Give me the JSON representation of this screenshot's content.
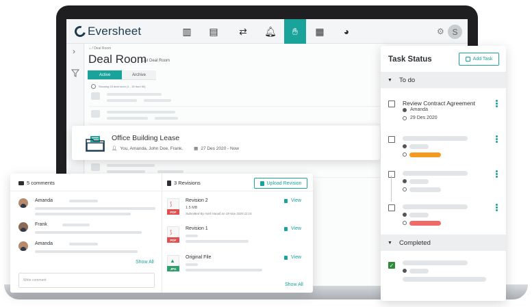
{
  "app": {
    "brand": "Eversheet",
    "avatar_letter": "S",
    "nav_icons": [
      "buildings-icon",
      "document-icon",
      "transfer-icon",
      "bell-icon",
      "handshake-icon",
      "clipboard-icon",
      "pie-chart-icon"
    ],
    "active_nav": "handshake-icon"
  },
  "deal_room": {
    "breadcrumb": "/ Deal Room",
    "title": "Deal Room",
    "subtitle": "List Deal Room",
    "tabs": [
      "Active",
      "Archive"
    ],
    "active_tab": "Active",
    "showing_text": "Showing 15 deal room (1 - 15 from 50)"
  },
  "featured_deal": {
    "title": "Office Building Lease",
    "members": "You, Amanda, John Doe, Frank.",
    "date_range": "27 Des 2020 - Now"
  },
  "comments": {
    "header": "5 comments",
    "items": [
      {
        "name": "Amanda"
      },
      {
        "name": "Frank"
      },
      {
        "name": "Amanda"
      }
    ],
    "show_all": "Show All",
    "write_placeholder": "Write comment"
  },
  "revisions": {
    "header": "3 Revisions",
    "upload_label": "Upload Revision",
    "items": [
      {
        "name": "Revision 2",
        "size": "1.5 MB",
        "submitted": "Submitted By Arief Hanafi on 19 Nov 2020 11:15",
        "type": "PDF",
        "view": "View"
      },
      {
        "name": "Revision 1",
        "size": "",
        "submitted": "",
        "type": "PDF",
        "view": "View"
      },
      {
        "name": "Original File",
        "size": "",
        "submitted": "",
        "type": "JPG",
        "view": "View"
      }
    ],
    "show_all": "Show All"
  },
  "task_status": {
    "title": "Task Status",
    "add_label": "Add Task",
    "todo_label": "To do",
    "completed_label": "Completed",
    "first_task": {
      "name": "Review Contract Agreement",
      "assignee": "Amanda",
      "date": "29 Des 2020"
    },
    "status_colors": {
      "orange": "#f59a1f",
      "red": "#f06a6a"
    }
  },
  "colors": {
    "accent": "#1aa39a",
    "dark": "#1c3b50"
  }
}
